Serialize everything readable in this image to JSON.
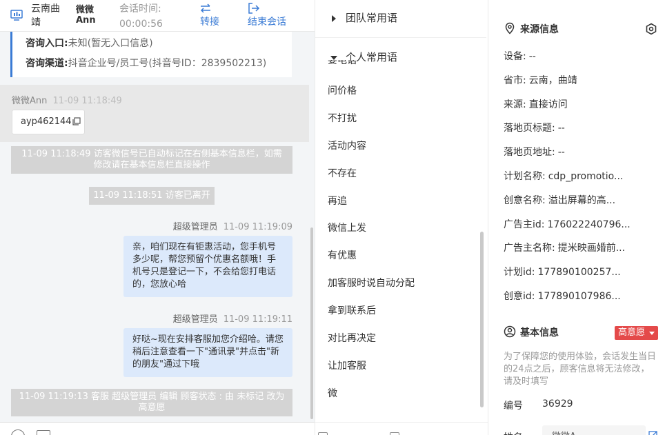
{
  "header": {
    "location": "云南曲靖",
    "visitor_name": "微微Ann",
    "session_time_label": "会话时间:",
    "session_time_value": "00:00:56",
    "transfer_label": "转接",
    "end_label": "结束会话",
    "accent_color": "#3a7bd5"
  },
  "chat": {
    "info_card": {
      "entry_label": "咨询入口:",
      "entry_value": "未知(暂无入口信息)",
      "channel_label": "咨询渠道:",
      "channel_value": "抖音企业号/员工号(抖音号ID：2839502213)"
    },
    "visitor_message": {
      "sender": "微微Ann",
      "time": "11-09 11:18:49",
      "text": "ayp462144"
    },
    "system_messages": [
      "11-09 11:18:49 访客微信号已自动标记在右侧基本信息栏，如需修改请在基本信息栏直接操作",
      "11-09 11:18:51 访客已离开",
      "11-09 11:19:13 客服 超级管理员 编辑 顾客状态 : 由 未标记 改为 高意愿"
    ],
    "agent_messages": [
      {
        "sender": "超级管理员",
        "time": "11-09 11:19:09",
        "text": "亲，咱们现在有钜惠活动，您手机号多少呢，帮您预留个优惠名额哦！手机号只是登记一下，不会给您打电话的，您放心哈"
      },
      {
        "sender": "超级管理员",
        "time": "11-09 11:19:11",
        "text": "好哒~现在安排客服加您介绍哈。请您稍后注意查看一下\"通讯录\"并点击\"新的朋友\"通过下哦"
      }
    ]
  },
  "phrases": {
    "team_group": "团队常用语",
    "personal_group": "个人常用语",
    "partial_item": "要电话",
    "items": [
      "问价格",
      "不打扰",
      "活动内容",
      "不存在",
      "再追",
      "微信上发",
      "有优惠",
      "加客服时说自动分配",
      "拿到联系后",
      "对比再决定",
      "让加客服",
      "微"
    ]
  },
  "info": {
    "source_title": "来源信息",
    "source_fields": [
      {
        "label": "设备:",
        "value": "--"
      },
      {
        "label": "省市:",
        "value": "云南，曲靖"
      },
      {
        "label": "来源:",
        "value": "直接访问"
      },
      {
        "label": "落地页标题:",
        "value": "--"
      },
      {
        "label": "落地页地址:",
        "value": "--"
      },
      {
        "label": "计划名称:",
        "value": "cdp_promotio..."
      },
      {
        "label": "创意名称:",
        "value": "溢出屏幕的高..."
      },
      {
        "label": "广告主id:",
        "value": "176022240796..."
      },
      {
        "label": "广告主名称:",
        "value": "提米映画婚前..."
      },
      {
        "label": "计划id:",
        "value": "177890100257..."
      },
      {
        "label": "创意id:",
        "value": "177890107986..."
      }
    ],
    "basic_title": "基本信息",
    "intent_tag": "高意愿",
    "intent_color": "#e44a4a",
    "notice": "为了保障您的使用体验，会话发生当日的24点之后，顾客信息将无法修改，请及时填写",
    "id_label": "编号",
    "id_value": "36929",
    "name_label": "姓名",
    "name_value": "微微A..."
  }
}
